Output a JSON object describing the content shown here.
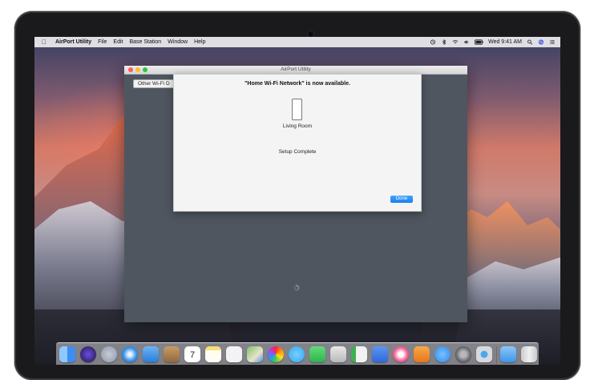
{
  "menubar": {
    "app_name": "AirPort Utility",
    "menus": [
      "File",
      "Edit",
      "Base Station",
      "Window",
      "Help"
    ],
    "clock": "Wed 9:41 AM"
  },
  "window": {
    "title": "AirPort Utility",
    "other_wifi_button": "Other Wi-Fi D"
  },
  "sheet": {
    "headline": "\"Home Wi-Fi Network\" is now available.",
    "device_name": "Living Room",
    "status": "Setup Complete",
    "done_label": "Done"
  },
  "dock": {
    "calendar_day": "7",
    "apps": [
      {
        "name": "finder-icon",
        "color": "#3d8ef0"
      },
      {
        "name": "siri-icon",
        "color": "#1b1b3a"
      },
      {
        "name": "launchpad-icon",
        "color": "#8f98a8"
      },
      {
        "name": "safari-icon",
        "color": "#2f8de4"
      },
      {
        "name": "mail-icon",
        "color": "#4a9ae8"
      },
      {
        "name": "contacts-icon",
        "color": "#b08456"
      },
      {
        "name": "calendar-icon",
        "color": "#ffffff"
      },
      {
        "name": "notes-icon",
        "color": "#f7e07a"
      },
      {
        "name": "reminders-icon",
        "color": "#f3f3f3"
      },
      {
        "name": "maps-icon",
        "color": "#7cc26c"
      },
      {
        "name": "photos-icon",
        "color": "#ffffff"
      },
      {
        "name": "messages-icon",
        "color": "#2ea8f2"
      },
      {
        "name": "facetime-icon",
        "color": "#38c454"
      },
      {
        "name": "photo-booth-icon",
        "color": "#d8d8d8"
      },
      {
        "name": "numbers-icon",
        "color": "#3fb04f"
      },
      {
        "name": "keynote-icon",
        "color": "#3d7ee8"
      },
      {
        "name": "itunes-icon",
        "color": "#f35b8f"
      },
      {
        "name": "ibooks-icon",
        "color": "#f08a24"
      },
      {
        "name": "app-store-icon",
        "color": "#2a8ae8"
      },
      {
        "name": "system-preferences-icon",
        "color": "#7c7c80"
      },
      {
        "name": "airport-utility-icon",
        "color": "#d9d9dd"
      },
      {
        "name": "downloads-folder-icon",
        "color": "#5aaef3"
      },
      {
        "name": "trash-icon",
        "color": "#dcdde0"
      }
    ]
  }
}
